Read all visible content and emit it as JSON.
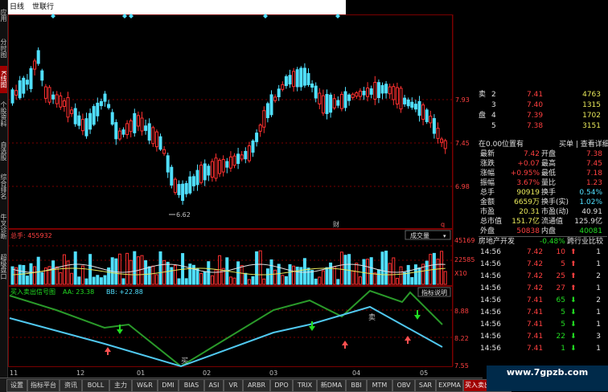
{
  "window": {
    "title_left": "日线",
    "title_right": "世联行"
  },
  "leftbar": [
    "应用",
    "分时图",
    "K线图",
    "个股资料",
    "自选股",
    "综合排名",
    "牛叉诊断",
    "超级盘口"
  ],
  "main_chart": {
    "y_ticks": [
      "7.93",
      "7.45",
      "6.98"
    ],
    "low_marker": "6.62",
    "financial_marker": "财",
    "q_marker": "q"
  },
  "volume": {
    "label": "总手: 455932",
    "dropdown": "成交量",
    "y_ticks": [
      "45169",
      "22585",
      "X10"
    ]
  },
  "indicator": {
    "label": "买入卖出信号图",
    "aa": "AA: 23.38",
    "bb": "BB: +22.88",
    "help_button": "指标说明",
    "y_ticks": [
      "8.88",
      "8.22",
      "7.55"
    ],
    "buy_text": "买",
    "sell_text": "卖"
  },
  "x_axis": [
    "11",
    "12",
    "01",
    "02",
    "03",
    "04",
    "05"
  ],
  "tabs": [
    "设置",
    "指标平台",
    "资讯",
    "BOLL",
    "主力",
    "W&R",
    "DMI",
    "BIAS",
    "ASI",
    "VR",
    "ARBR",
    "DPO",
    "TRIX",
    "新DMA",
    "BBI",
    "MTM",
    "OBV",
    "SAR",
    "EXPMA",
    "买入卖出信号图"
  ],
  "order_book": {
    "sell_label": "卖",
    "buy_label": "盘",
    "rows": [
      {
        "level": "2",
        "price": "7.41",
        "vol": "4763"
      },
      {
        "level": "3",
        "price": "7.40",
        "vol": "1315"
      },
      {
        "level": "4",
        "price": "7.39",
        "vol": "1702"
      },
      {
        "level": "5",
        "price": "7.38",
        "vol": "3151"
      }
    ],
    "header": "在0.00位置有",
    "header_link": "买单 | 查看详细"
  },
  "quote": {
    "rows": [
      {
        "l1": "最新",
        "v1": "7.42",
        "l2": "开盘",
        "v2": "7.38"
      },
      {
        "l1": "涨跌",
        "v1": "+0.07",
        "l2": "最高",
        "v2": "7.45"
      },
      {
        "l1": "涨幅",
        "v1": "+0.95%",
        "l2": "最低",
        "v2": "7.18"
      },
      {
        "l1": "振幅",
        "v1": "3.67%",
        "l2": "量比",
        "v2": "1.23"
      },
      {
        "l1": "总手",
        "v1": "90919",
        "l2": "换手",
        "v2": "0.54%"
      },
      {
        "l1": "金额",
        "v1": "6659万",
        "l2": "换手(实)",
        "v2": "1.02%"
      },
      {
        "l1": "市盈",
        "v1": "20.31",
        "l2": "市盈(动)",
        "v2": "40.91"
      },
      {
        "l1": "总市值",
        "v1": "151.7亿",
        "l2": "流通值",
        "v2": "125.9亿"
      },
      {
        "l1": "外盘",
        "v1": "50838",
        "l2": "内盘",
        "v2": "40081"
      }
    ]
  },
  "industry": {
    "name": "房地产开发",
    "change": "-0.48%",
    "compare": "跨行业比较"
  },
  "ticks": [
    {
      "time": "14:56",
      "price": "7.42",
      "vol": "10",
      "dir": "up",
      "n": "1"
    },
    {
      "time": "14:56",
      "price": "7.42",
      "vol": "5",
      "dir": "up",
      "n": "1"
    },
    {
      "time": "14:56",
      "price": "7.42",
      "vol": "25",
      "dir": "up",
      "n": "2"
    },
    {
      "time": "14:56",
      "price": "7.42",
      "vol": "27",
      "dir": "up",
      "n": "1"
    },
    {
      "time": "14:56",
      "price": "7.41",
      "vol": "65",
      "dir": "down",
      "n": "2"
    },
    {
      "time": "14:56",
      "price": "7.41",
      "vol": "5",
      "dir": "down",
      "n": "1"
    },
    {
      "time": "14:56",
      "price": "7.41",
      "vol": "5",
      "dir": "down",
      "n": "1"
    },
    {
      "time": "14:56",
      "price": "7.41",
      "vol": "22",
      "dir": "down",
      "n": "3"
    },
    {
      "time": "14:56",
      "price": "7.41",
      "vol": "1",
      "dir": "down",
      "n": "1"
    }
  ],
  "watermark": "www.7gpzb.com",
  "colors": {
    "up": "#ff3030",
    "down": "#50e0ff",
    "grid": "#7a0000",
    "green_line": "#2a9a2a",
    "blue_line": "#50c8f0"
  }
}
